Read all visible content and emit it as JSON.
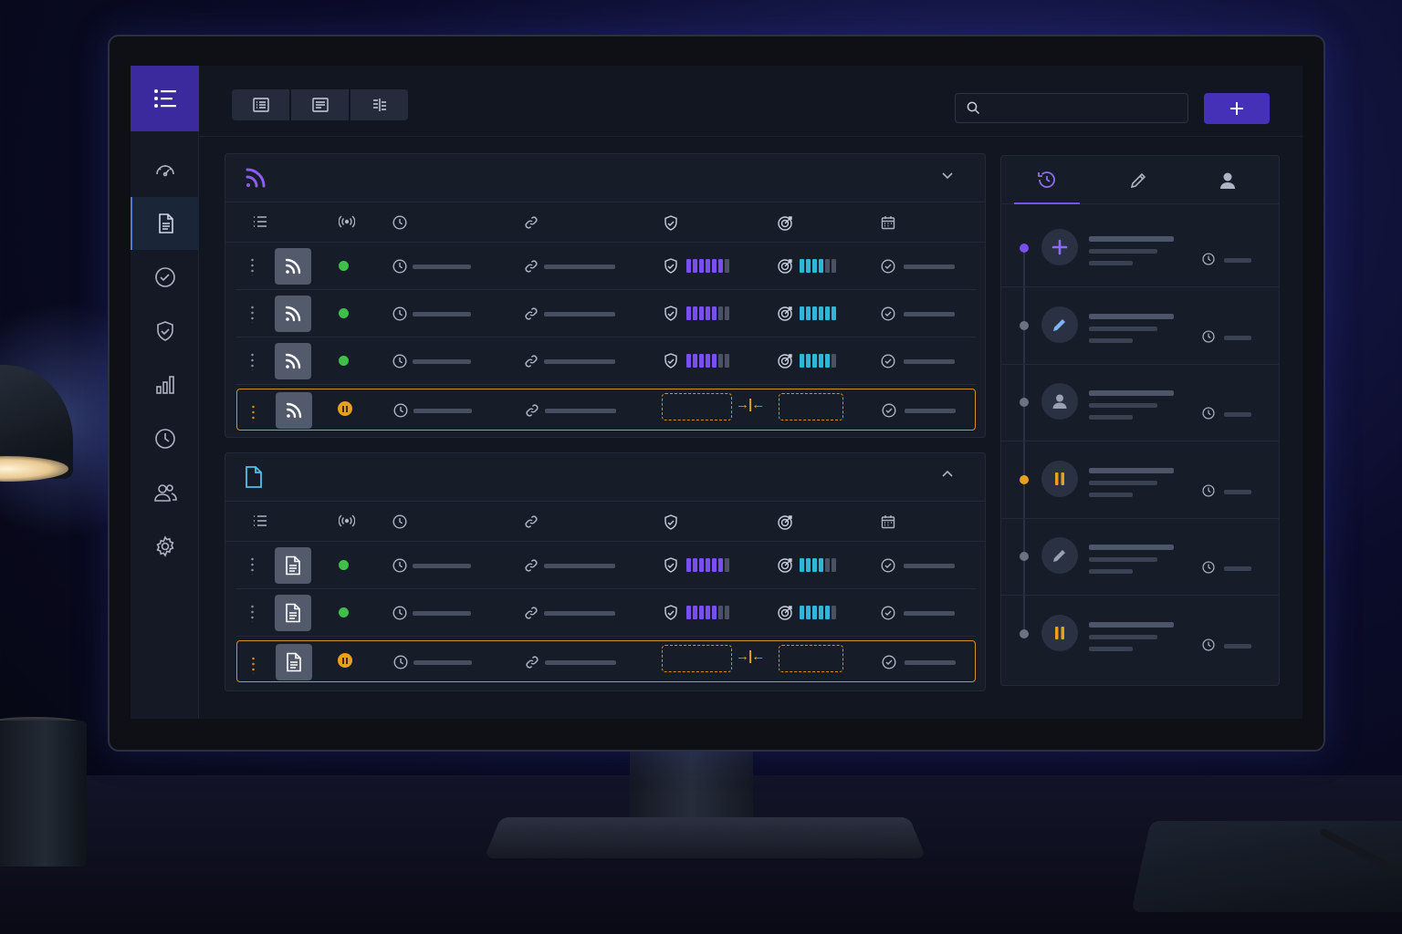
{
  "app": {
    "title": "",
    "accent": "#3b2a9e",
    "brand_purple": "#7a4ff0",
    "meter_cyan": "#2fb6d8",
    "warn_orange": "#e8a11f",
    "ok_green": "#3fbf4a"
  },
  "sidebar": {
    "menu_icon": "menu-list-icon",
    "items": [
      {
        "icon": "dashboard-gauge-icon",
        "active": false
      },
      {
        "icon": "document-icon",
        "active": true
      },
      {
        "icon": "check-circle-icon",
        "active": false
      },
      {
        "icon": "shield-check-icon",
        "active": false
      },
      {
        "icon": "bar-chart-icon",
        "active": false
      },
      {
        "icon": "clock-icon",
        "active": false
      },
      {
        "icon": "users-icon",
        "active": false
      },
      {
        "icon": "gear-icon",
        "active": false
      }
    ]
  },
  "toolbar": {
    "view_tabs": [
      "list-view-icon",
      "detail-view-icon",
      "split-view-icon"
    ],
    "search": {
      "placeholder": "",
      "value": ""
    },
    "add_label": "+"
  },
  "sections": [
    {
      "icon": "rss-feed-icon",
      "title": "",
      "collapsed_indicator": "chevron-down-icon",
      "columns": [
        "list-icon",
        "broadcast-icon",
        "clock-icon",
        "link-icon",
        "shield-check-icon",
        "target-icon",
        "calendar-icon"
      ],
      "rows": [
        {
          "thumb": "rss-feed-icon",
          "status": "ok",
          "shield_level": 0.85,
          "target_level": 0.67
        },
        {
          "thumb": "rss-feed-icon",
          "status": "ok",
          "shield_level": 0.71,
          "target_level": 1.0
        },
        {
          "thumb": "rss-feed-icon",
          "status": "ok",
          "shield_level": 0.71,
          "target_level": 0.83
        },
        {
          "thumb": "rss-feed-icon",
          "status": "paused",
          "merge": true
        }
      ]
    },
    {
      "icon": "document-icon",
      "title": "",
      "collapsed_indicator": "chevron-up-icon",
      "columns": [
        "list-icon",
        "broadcast-icon",
        "clock-icon",
        "link-icon",
        "shield-check-icon",
        "target-icon",
        "calendar-icon"
      ],
      "rows": [
        {
          "thumb": "document-icon",
          "status": "ok",
          "shield_level": 0.85,
          "target_level": 0.67
        },
        {
          "thumb": "document-icon",
          "status": "ok",
          "shield_level": 0.71,
          "target_level": 0.83
        },
        {
          "thumb": "document-icon",
          "status": "paused",
          "merge": true
        }
      ]
    }
  ],
  "activity": {
    "tabs": [
      "history-icon",
      "pencil-icon",
      "user-icon"
    ],
    "active_tab": 0,
    "items": [
      {
        "icon": "plus-icon",
        "color": "#8b6cf5",
        "dot": "#7a4ff0"
      },
      {
        "icon": "pencil-icon",
        "color": "#7fb3f5",
        "dot": "#6b7284"
      },
      {
        "icon": "user-icon",
        "color": "#9aa1b3",
        "dot": "#6b7284"
      },
      {
        "icon": "pause-icon",
        "color": "#e8a11f",
        "dot": "#e8a11f"
      },
      {
        "icon": "pencil-icon",
        "color": "#9aa1b3",
        "dot": "#6b7284"
      },
      {
        "icon": "pause-icon",
        "color": "#e8a11f",
        "dot": "#6b7284"
      }
    ]
  }
}
